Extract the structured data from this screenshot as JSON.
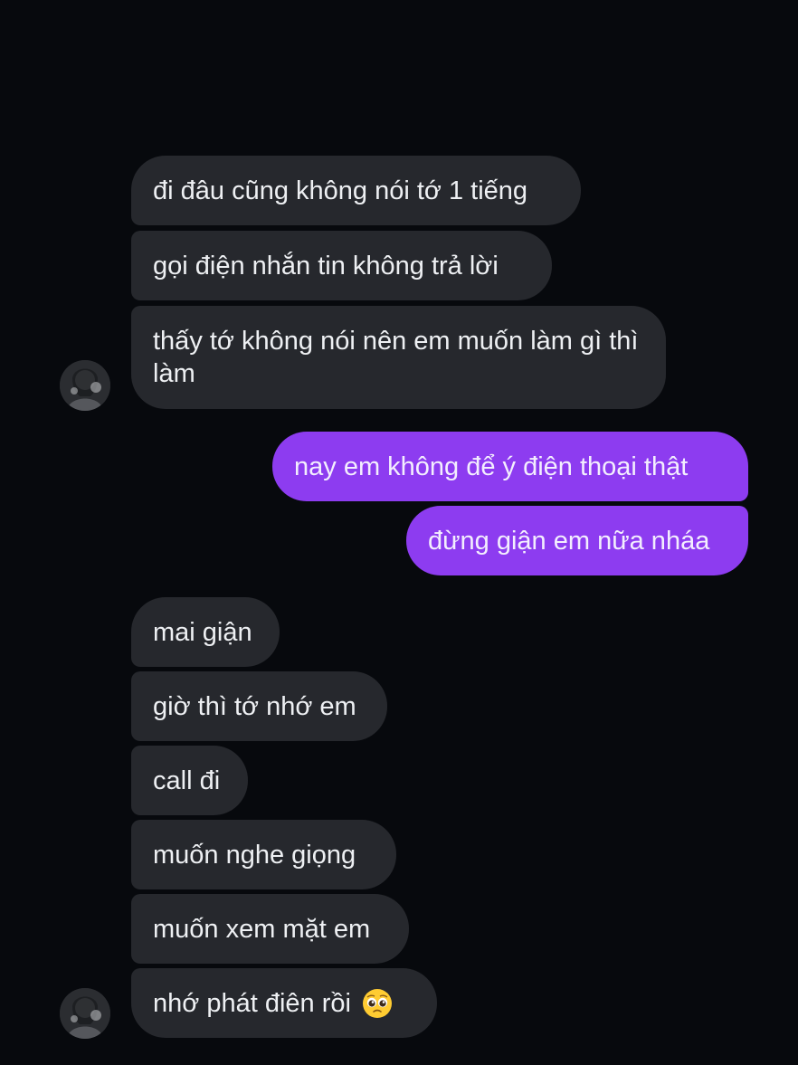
{
  "incoming_group_1": [
    "đi đâu cũng không nói tớ 1 tiếng",
    "gọi điện nhắn tin không trả lời",
    "thấy tớ không nói nên em muốn làm gì thì làm"
  ],
  "outgoing_group": [
    "nay em không để ý điện thoại thật",
    "đừng giận em nữa nháa"
  ],
  "incoming_group_2": [
    "mai giận",
    "giờ thì tớ nhớ em",
    "call đi",
    "muốn nghe giọng",
    "muốn xem mặt em",
    "nhớ phát điên rồi"
  ],
  "last_message_emoji": "pleading-face-emoji",
  "colors": {
    "background": "#07090d",
    "incoming_bubble": "#26282d",
    "outgoing_bubble": "#8d3cf0",
    "text_light": "#eef0f3"
  }
}
